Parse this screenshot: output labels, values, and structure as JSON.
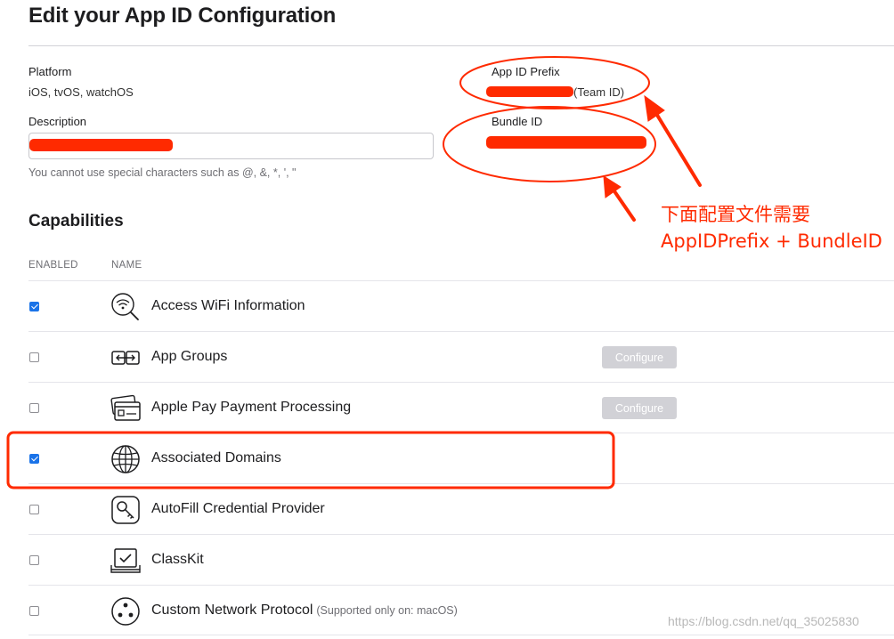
{
  "page": {
    "title": "Edit your App ID Configuration"
  },
  "platform": {
    "label": "Platform",
    "value": "iOS, tvOS, watchOS"
  },
  "description": {
    "label": "Description",
    "hint": "You cannot use special characters such as @, &, *, ', \""
  },
  "app_id_prefix": {
    "label": "App ID Prefix",
    "suffix": "(Team ID)"
  },
  "bundle_id": {
    "label": "Bundle ID"
  },
  "capabilities": {
    "title": "Capabilities",
    "col_enabled": "ENABLED",
    "col_name": "NAME",
    "configure_label": "Configure",
    "rows": [
      {
        "name": "Access WiFi Information",
        "enabled": true,
        "icon": "wifi-search-icon"
      },
      {
        "name": "App Groups",
        "enabled": false,
        "icon": "app-groups-icon",
        "configure": true
      },
      {
        "name": "Apple Pay Payment Processing",
        "enabled": false,
        "icon": "wallet-card-icon",
        "configure": true
      },
      {
        "name": "Associated Domains",
        "enabled": true,
        "icon": "globe-icon"
      },
      {
        "name": "AutoFill Credential Provider",
        "enabled": false,
        "icon": "key-icon"
      },
      {
        "name": "ClassKit",
        "enabled": false,
        "icon": "classkit-icon"
      },
      {
        "name": "Custom Network Protocol",
        "enabled": false,
        "icon": "network-protocol-icon",
        "note": "(Supported only on: macOS)"
      }
    ]
  },
  "annotation": {
    "line1": "下面配置文件需要",
    "line2": "AppIDPrefix + BundleID",
    "color": "#ff2a00"
  },
  "watermark": "https://blog.csdn.net/qq_35025830"
}
